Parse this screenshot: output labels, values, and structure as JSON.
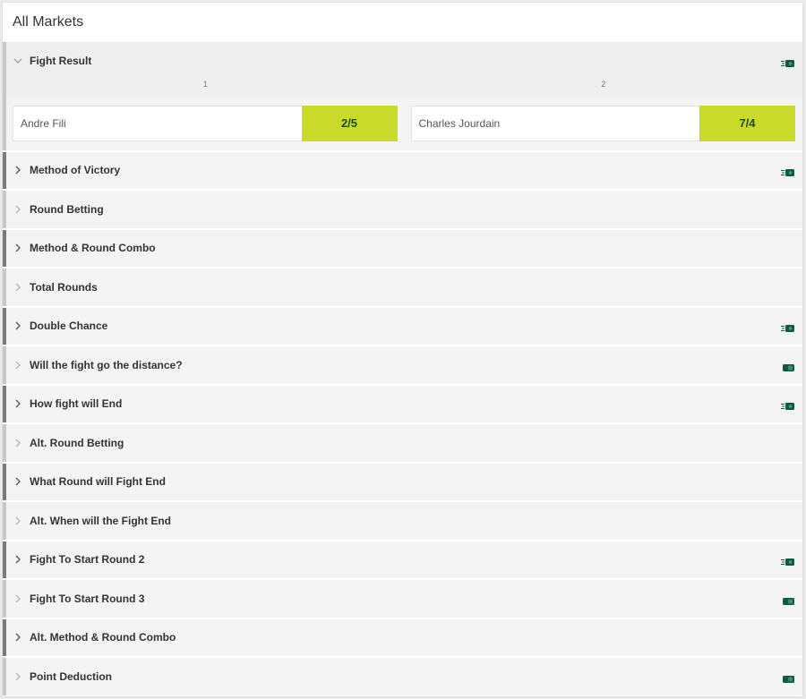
{
  "header": {
    "title": "All Markets"
  },
  "colors": {
    "odds_bg": "#c9da2a",
    "odds_text": "#1e4a2a",
    "cash_icon": "#0d5a3c"
  },
  "markets": [
    {
      "title": "Fight Result",
      "expanded": true,
      "icon": "fast-cash-out-icon",
      "column_labels": [
        "1",
        "2"
      ],
      "selections": [
        {
          "name": "Andre Fili",
          "odds": "2/5"
        },
        {
          "name": "Charles Jourdain",
          "odds": "7/4"
        }
      ]
    },
    {
      "title": "Method of Victory",
      "icon": "fast-cash-out-icon"
    },
    {
      "title": "Round Betting",
      "icon": null
    },
    {
      "title": "Method & Round Combo",
      "icon": null
    },
    {
      "title": "Total Rounds",
      "icon": null
    },
    {
      "title": "Double Chance",
      "icon": "fast-cash-out-icon"
    },
    {
      "title": "Will the fight go the distance?",
      "icon": "cash-out-icon"
    },
    {
      "title": "How fight will End",
      "icon": "fast-cash-out-icon"
    },
    {
      "title": "Alt. Round Betting",
      "icon": null
    },
    {
      "title": "What Round will Fight End",
      "icon": null
    },
    {
      "title": "Alt. When will the Fight End",
      "icon": null
    },
    {
      "title": "Fight To Start Round 2",
      "icon": "fast-cash-out-icon"
    },
    {
      "title": "Fight To Start Round 3",
      "icon": "cash-out-icon"
    },
    {
      "title": "Alt. Method & Round Combo",
      "icon": null
    },
    {
      "title": "Point Deduction",
      "icon": "cash-out-icon"
    }
  ]
}
